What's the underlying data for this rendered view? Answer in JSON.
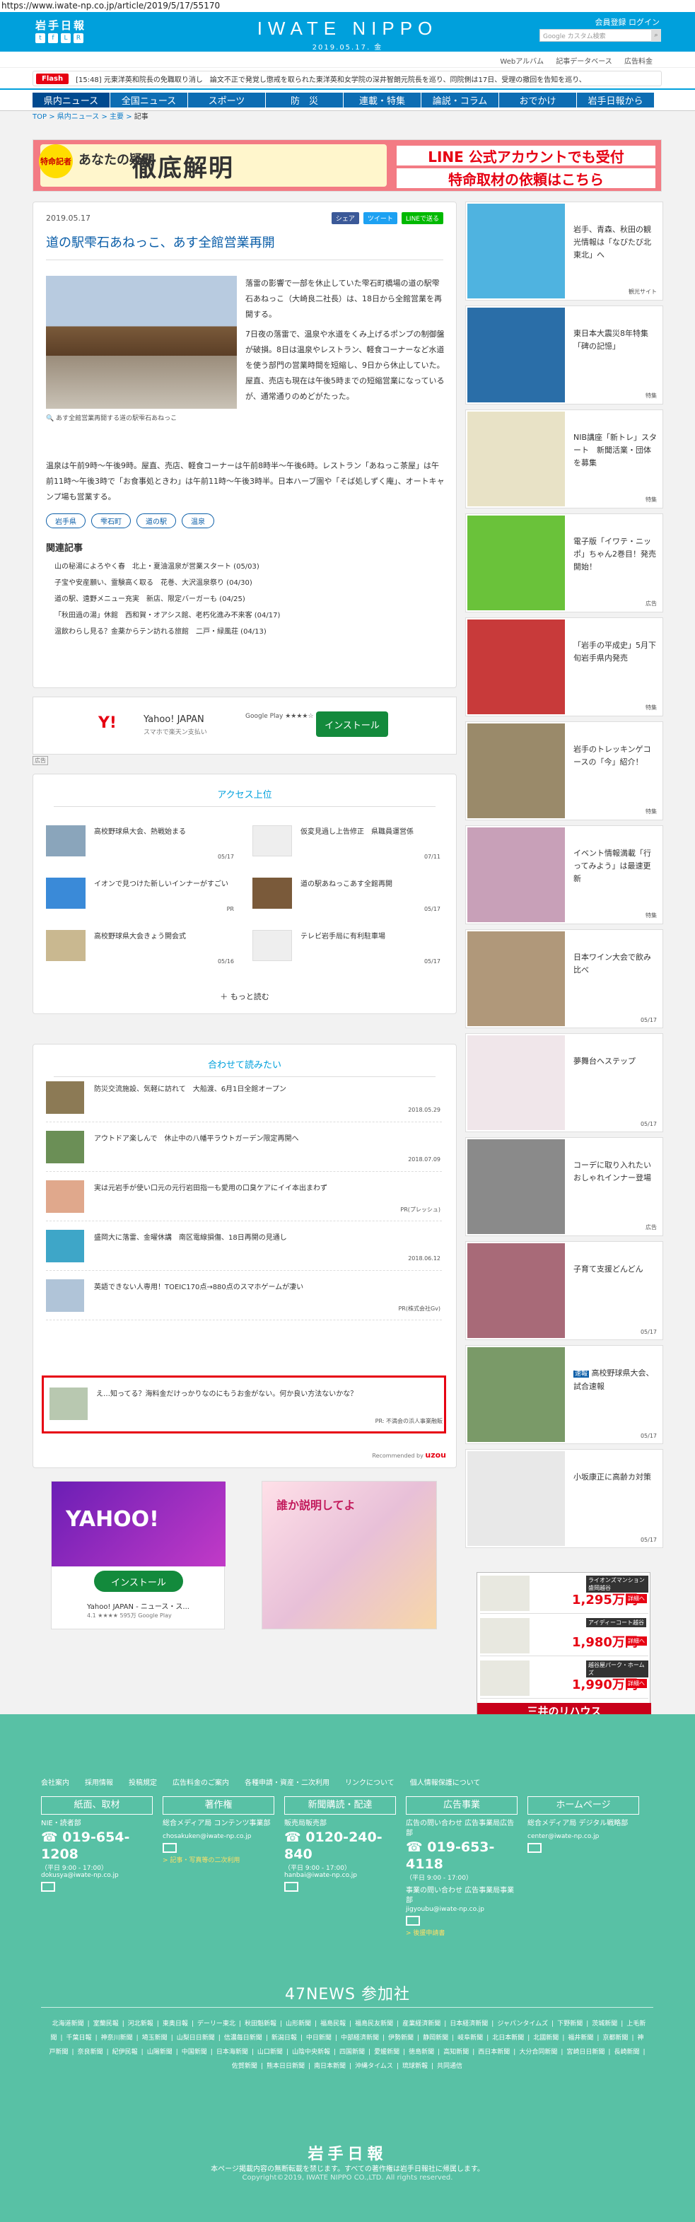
{
  "url": "https://www.iwate-np.co.jp/article/2019/5/17/55170",
  "header": {
    "logo_small": "岩手日報",
    "brand": "IWATE NIPPO",
    "date": "2019.05.17. 金",
    "account_links": "会員登録 ログイン",
    "search_placeholder": "Google カスタム検索",
    "sublinks": [
      "Webアルバム",
      "記事データベース",
      "広告料金"
    ]
  },
  "flash": {
    "tag": "Flash",
    "text": "[15:48] 元東洋英和院長の免職取り消し　論文不正で発覚し懲戒を取られた東洋英和女学院の深井智朗元院長を巡り、同院側は17日、受理の撤回を告知を巡り、"
  },
  "nav": [
    "県内ニュース",
    "全国ニュース",
    "スポーツ",
    "防　災",
    "連載・特集",
    "論説・コラム",
    "おでかけ",
    "岩手日報から"
  ],
  "breadcrumb": {
    "items": [
      "TOP",
      "県内ニュース",
      "主要"
    ],
    "current": "記事"
  },
  "banner": {
    "tag": "特命記者",
    "question": "あなたの疑問",
    "headline": "徹底解明",
    "right1": "LINE 公式アカウントでも受付",
    "right2": "特命取材の依頼はこちら"
  },
  "article": {
    "date": "2019.05.17",
    "share": [
      "シェア",
      "ツイート",
      "LINEで送る"
    ],
    "title": "道の駅雫石あねっこ、あす全館営業再開",
    "caption": "あす全館営業再開する道の駅雫石あねっこ",
    "p1": "落雷の影響で一部を休止していた雫石町橋場の道の駅雫石あねっこ（大崎良二社長）は、18日から全館営業を再開する。",
    "p2": "7日夜の落雷で、温泉や水道をくみ上げるポンプの制御盤が破損。8日は温泉やレストラン、軽食コーナーなど水道を使う部門の営業時間を短縮し、9日から休止していた。屋直、売店も現在は午後5時までの短縮営業になっているが、通常通りのめどがたった。",
    "p3": "温泉は午前9時〜午後9時。屋直、売店、軽食コーナーは午前8時半〜午後6時。レストラン「あねっこ茶屋」は午前11時〜午後3時で「お食事処ときわ」は午前11時〜午後3時半。日本ハーブ園や「そば処しずく庵」、オートキャンプ場も営業する。",
    "tags": [
      "岩手県",
      "雫石町",
      "道の駅",
      "温泉"
    ],
    "related_heading": "関連記事",
    "related": [
      "山の秘湯によろやく春　北上・夏油温泉が営業スタート (05/03)",
      "子宝や安産願い、霊験高く取る　花巻、大沢温泉祭り (04/30)",
      "道の駅、遠野メニュー充実　新店、限定バーガーも (04/25)",
      "「秋田過の湯」休館　西和賀・オアシス館、老朽化進み不来客 (04/17)",
      "温飲わらし見る？金薬からテン訪れる旅館　二戸・緑風荘 (04/13)"
    ]
  },
  "ad_yahoo": {
    "logo": "Y! Yahoo! JAPAN",
    "title": "Yahoo! JAPAN",
    "sub": "スマホで楽天ン支払い",
    "store": "Google Play ★★★★☆",
    "button": "インストール",
    "mark": "広告"
  },
  "access": {
    "heading": "アクセス上位",
    "items": [
      {
        "title": "高校野球県大会、熱戦始まる",
        "date": "05/17"
      },
      {
        "title": "仮変見過し上告修正　県職員運営係",
        "date": "07/11"
      },
      {
        "title": "イオンで見つけた新しいインナーがすごい",
        "date": "PR"
      },
      {
        "title": "道の駅あねっこあす全館再開",
        "date": "05/17"
      },
      {
        "title": "高校野球県大会きょう開会式",
        "date": "05/16"
      },
      {
        "title": "テレビ岩手局に有利駐車場",
        "date": "05/17"
      }
    ],
    "more": "もっと読む"
  },
  "recommend": {
    "heading": "合わせて読みたい",
    "items": [
      {
        "title": "防災交流施設、気軽に訪れて　大船渡、6月1日全館オープン",
        "date": "2018.05.29"
      },
      {
        "title": "アウトドア楽しんで　休止中の八幡平ラウトガーデン限定再開へ",
        "date": "2018.07.09"
      },
      {
        "title": "実は元岩手が使い口元の元行岩田指一も愛用の口臭ケアにイイ本出まわず",
        "date": "PR(プレッシュ)"
      },
      {
        "title": "盛岡大に落雷、金曜休講　南区電線損傷、18日再開の見通し",
        "date": "2018.06.12"
      },
      {
        "title": "英語できない人専用！TOEIC170点→880点のスマホゲームが凄い",
        "date": "PR(株式会社Gv)"
      },
      {
        "title": "え…知ってる？海料金だけっかりなのにもうお金がない。何か良い方法ないかな？",
        "date": "PR: 不満会の浜人事業融販"
      }
    ],
    "powered": "Recommended by",
    "uzou": "uzou"
  },
  "bottom_ads": {
    "yahoo_logo": "YAHOO!",
    "button": "インストール",
    "title": "Yahoo! JAPAN - ニュース・ス...",
    "sub": "4.1 ★★★★ 595万 Google Play",
    "manga": "誰か説明してよ"
  },
  "sidebar": [
    {
      "title": "岩手、青森、秋田の観光情報は「なびたび北東北」へ",
      "label": "観光サイト"
    },
    {
      "title": "東日本大震災8年特集「碑の記憶」",
      "label": "特集"
    },
    {
      "title": "NIB講座「新トレ」スタート　新聞活業・団体を募集",
      "label": "特集"
    },
    {
      "title": "電子版「イワテ・ニッポ」ちゃん2巻目！発売開始！",
      "label": "広告"
    },
    {
      "title": "「岩手の平成史」5月下旬岩手県内発売",
      "label": "特集"
    },
    {
      "title": "岩手のトレッキンゲコースの「今」紹介！",
      "label": "特集"
    },
    {
      "title": "イベント情報満載「行ってみよう」は最速更新",
      "label": "特集"
    },
    {
      "title": "日本ワイン大会で飲み比べ",
      "label": "05/17"
    },
    {
      "title": "夢舞台へステップ",
      "label": "05/17"
    },
    {
      "title": "コーデに取り入れたいおしゃれインナー登場",
      "label": "広告"
    },
    {
      "title": "子育て支援どんどん",
      "label": "05/17"
    },
    {
      "title": "高校野球県大会、試合速報",
      "badge": "速報",
      "label": "05/17"
    },
    {
      "title": "小坂康正に高齢カ対策",
      "label": "05/17"
    }
  ],
  "mansion": {
    "rows": [
      {
        "name": "ライオンズマンション盛岡越谷",
        "price": "1,295万円"
      },
      {
        "name": "アイディーコート越谷",
        "price": "1,980万円"
      },
      {
        "name": "越谷屋パーク・ホームズ",
        "price": "1,990万円"
      }
    ],
    "badge": "詳細へ",
    "footer": "三井のリハウス"
  },
  "footer": {
    "links": [
      "会社案内",
      "採用情報",
      "投稿規定",
      "広告料金のご案内",
      "各種申請・資産・二次利用",
      "リンクについて",
      "個人情報保護について"
    ],
    "cols": [
      {
        "heading": "紙面、取材",
        "label": "NIE・読者部",
        "tel": "019-654-1208",
        "hours": "（平日 9:00 - 17:00）",
        "email": "dokusya@iwate-np.co.jp"
      },
      {
        "heading": "著作権",
        "label": "総合メディア局 コンテンツ事業部",
        "email": "chosakuken@iwate-np.co.jp",
        "link": "> 記事・写真等の二次利用"
      },
      {
        "heading": "新聞購読・配達",
        "label": "販売局販売部",
        "tel": "0120-240-840",
        "hours": "（平日 9:00 - 17:00）",
        "email": "hanbai@iwate-np.co.jp"
      },
      {
        "heading": "広告事業",
        "label": "広告の問い合わせ 広告事業局広告部",
        "tel": "019-653-4118",
        "hours": "（平日 9:00 - 17:00）",
        "label2": "事業の問い合わせ 広告事業局事業部",
        "email": "jigyoubu@iwate-np.co.jp",
        "link": "> 後援申請書"
      },
      {
        "heading": "ホームページ",
        "label": "総合メディア局 デジタル戦略部",
        "email": "center@iwate-np.co.jp"
      }
    ],
    "news47": "47NEWS 参加社",
    "papers": [
      "北海道新聞",
      "室蘭民報",
      "河北新報",
      "東奥日報",
      "デーリー東北",
      "秋田魁新報",
      "山形新聞",
      "福島民報",
      "福島民友新聞",
      "産業経済新聞",
      "日本経済新聞",
      "ジャパンタイムズ",
      "下野新聞",
      "茨城新聞",
      "上毛新聞",
      "千葉日報",
      "神奈川新聞",
      "埼玉新聞",
      "山梨日日新聞",
      "信濃毎日新聞",
      "新潟日報",
      "中日新聞",
      "中部経済新聞",
      "伊勢新聞",
      "静岡新聞",
      "岐阜新聞",
      "北日本新聞",
      "北國新聞",
      "福井新聞",
      "京都新聞",
      "神戸新聞",
      "奈良新聞",
      "紀伊民報",
      "山陽新聞",
      "中国新聞",
      "日本海新聞",
      "山口新聞",
      "山陰中央新報",
      "四国新聞",
      "愛媛新聞",
      "徳島新聞",
      "高知新聞",
      "西日本新聞",
      "大分合同新聞",
      "宮崎日日新聞",
      "長崎新聞",
      "佐賀新聞",
      "熊本日日新聞",
      "南日本新聞",
      "沖縄タイムス",
      "琉球新報",
      "共同通信"
    ],
    "logo": "岩手日報",
    "notice": "本ページ掲載内容の無断転載を禁じます。すべての著作権は岩手日報社に帰属します。",
    "copyright": "Copyright©2019, IWATE NIPPO CO.,LTD. All rights reserved."
  }
}
